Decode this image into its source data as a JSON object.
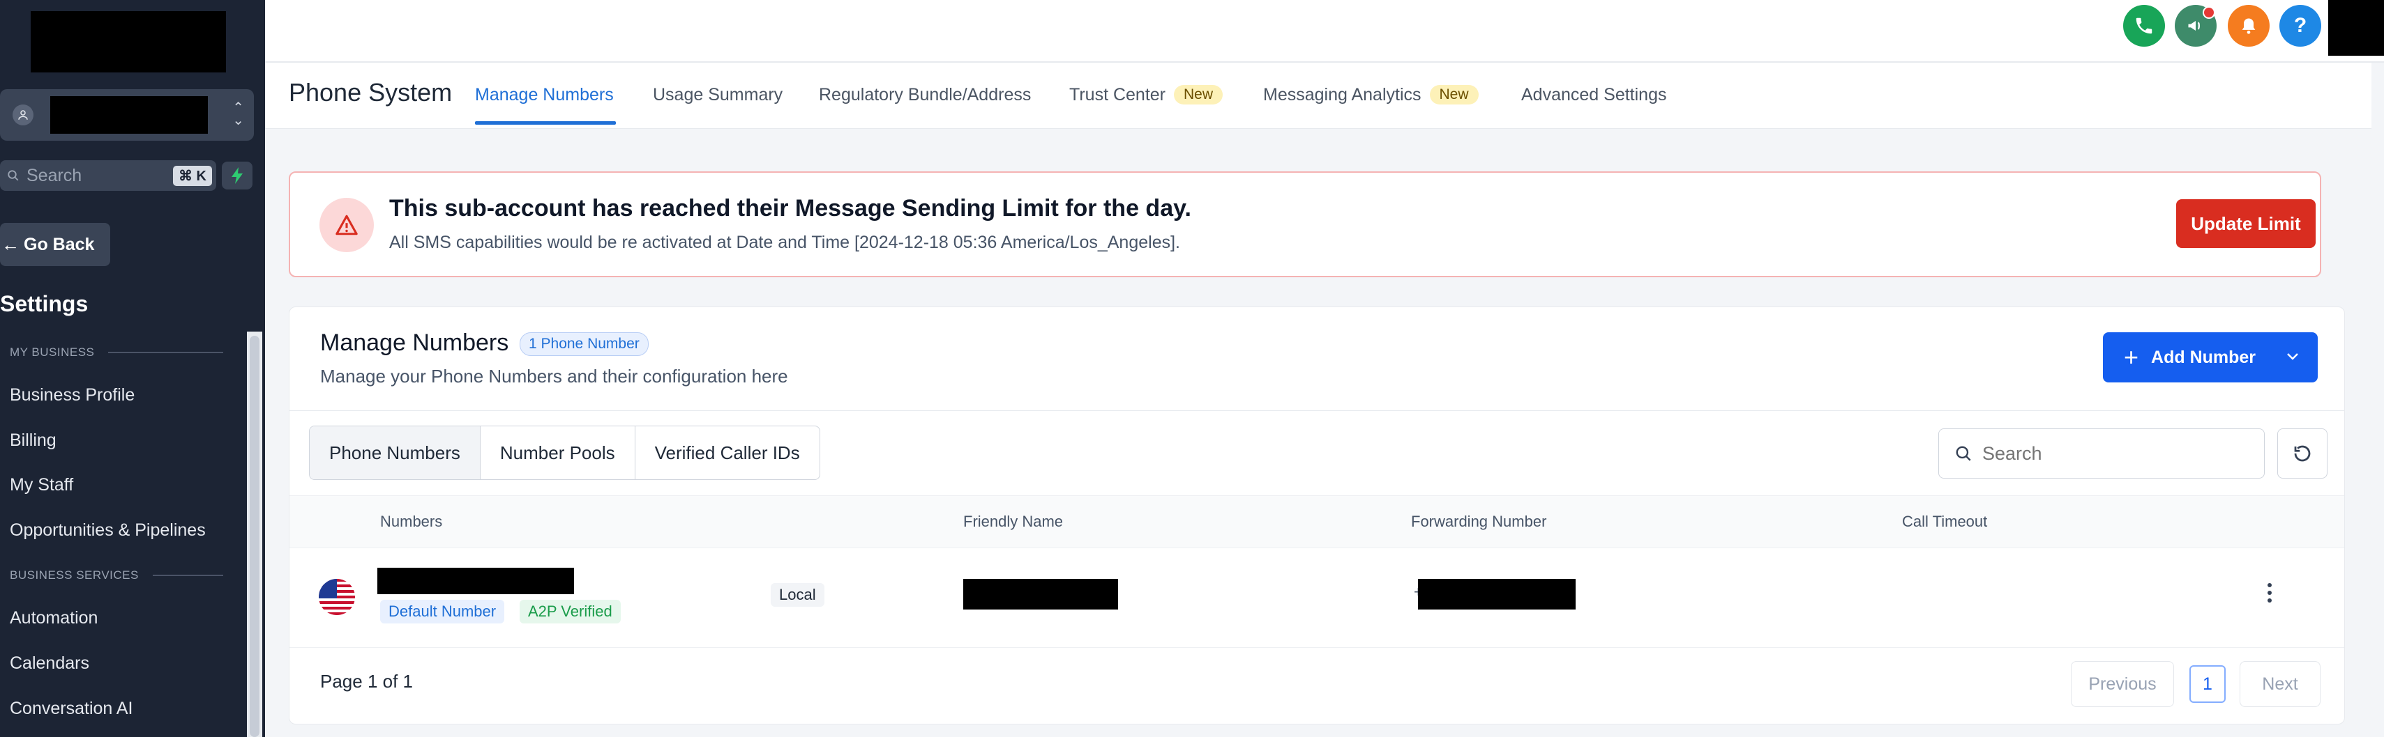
{
  "sidebar": {
    "search_label": "Search",
    "search_shortcut": "⌘ K",
    "go_back": "Go Back",
    "heading": "Settings",
    "sections": [
      {
        "label": "MY BUSINESS",
        "items": [
          "Business Profile",
          "Billing",
          "My Staff",
          "Opportunities & Pipelines"
        ]
      },
      {
        "label": "BUSINESS SERVICES",
        "items": [
          "Automation",
          "Calendars",
          "Conversation AI"
        ]
      }
    ]
  },
  "topbar": {
    "icons": [
      "phone-icon",
      "megaphone-icon",
      "bell-icon",
      "help-icon"
    ],
    "colors": {
      "phone": "#18a558",
      "megaphone": "#3e8b6a",
      "bell": "#f57c1f",
      "help": "#1e88e5"
    }
  },
  "nav": {
    "title": "Phone System",
    "tabs": [
      {
        "label": "Manage Numbers",
        "active": true
      },
      {
        "label": "Usage Summary"
      },
      {
        "label": "Regulatory Bundle/Address"
      },
      {
        "label": "Trust Center",
        "badge": "New"
      },
      {
        "label": "Messaging Analytics",
        "badge": "New"
      },
      {
        "label": "Advanced Settings"
      }
    ]
  },
  "alert": {
    "title": "This sub-account has reached their Message Sending Limit for the day.",
    "message": "All SMS capabilities would be re activated at Date and Time [2024-12-18 05:36 America/Los_Angeles].",
    "button": "Update Limit"
  },
  "manage": {
    "title": "Manage Numbers",
    "count_badge": "1 Phone Number",
    "subtitle": "Manage your Phone Numbers and their configuration here",
    "add_button": "Add Number",
    "segments": [
      "Phone Numbers",
      "Number Pools",
      "Verified Caller IDs"
    ],
    "search_placeholder": "Search",
    "columns": [
      "Numbers",
      "Friendly Name",
      "Forwarding Number",
      "Call Timeout"
    ],
    "rows": [
      {
        "country_flag": "us-flag-icon",
        "tags": [
          "Default Number",
          "A2P Verified"
        ],
        "type": "Local",
        "forwarding_prefix": "+"
      }
    ],
    "pagination": {
      "info": "Page 1 of 1",
      "previous": "Previous",
      "current": "1",
      "next": "Next"
    }
  }
}
